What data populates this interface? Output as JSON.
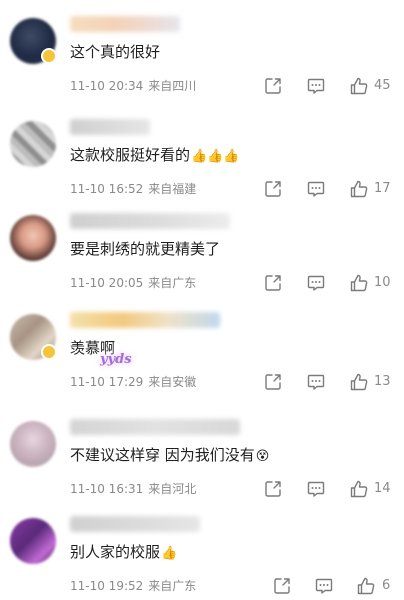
{
  "comments": [
    {
      "text": "这个真的很好",
      "emoji": "",
      "date": "11-10 20:34",
      "location": "来自四川",
      "likes": "45"
    },
    {
      "text": "这款校服挺好看的",
      "emoji": "👍👍👍",
      "date": "11-10 16:52",
      "location": "来自福建",
      "likes": "17"
    },
    {
      "text": "要是刺绣的就更精美了",
      "emoji": "",
      "date": "11-10 20:05",
      "location": "来自广东",
      "likes": "10"
    },
    {
      "text": "羡慕啊",
      "emoji": "",
      "date": "11-10 17:29",
      "location": "来自安徽",
      "likes": "13"
    },
    {
      "text": "不建议这样穿 因为我们没有",
      "emoji": "😵",
      "date": "11-10 16:31",
      "location": "来自河北",
      "likes": "14"
    },
    {
      "text": "别人家的校服",
      "emoji": "👍",
      "date": "11-10 19:52",
      "location": "来自广东",
      "likes": "6"
    }
  ],
  "sticker": {
    "text": "yyds"
  },
  "icons": {
    "share": "share-icon",
    "comment": "comment-icon",
    "like": "thumbs-up-icon"
  },
  "colors": {
    "meta_text": "#8a8a8a",
    "icon_stroke": "#7a7a7a",
    "verified_badge": "#f4c43b"
  }
}
